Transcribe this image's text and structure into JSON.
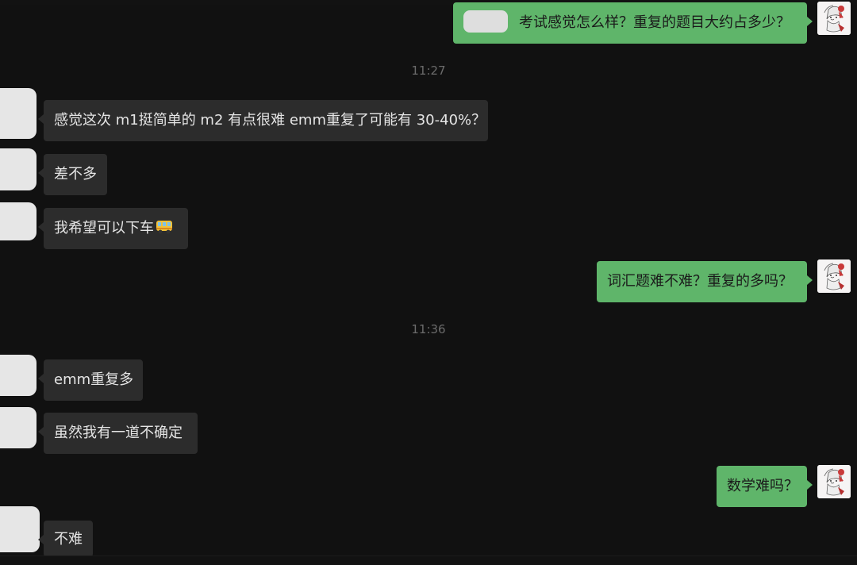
{
  "timestamps": [
    "11:27",
    "11:36"
  ],
  "messages": {
    "m1": "考试感觉怎么样？重复的题目大约占多少？",
    "m2": "感觉这次 m1挺简单的 m2 有点很难 emm重复了可能有 30-40%？",
    "m3": "差不多",
    "m4": "我希望可以下车",
    "m5": "词汇题难不难？重复的多吗？",
    "m6": "emm重复多",
    "m7": "虽然我有一道不确定",
    "m8": "数学难吗？",
    "m9": "不难"
  },
  "icons": {
    "bus": "bus-emoji",
    "avatar_self": "anime-girl-avatar"
  },
  "colors": {
    "background": "#111111",
    "bubble_incoming": "#2c2c2c",
    "bubble_outgoing": "#5fb56a"
  }
}
